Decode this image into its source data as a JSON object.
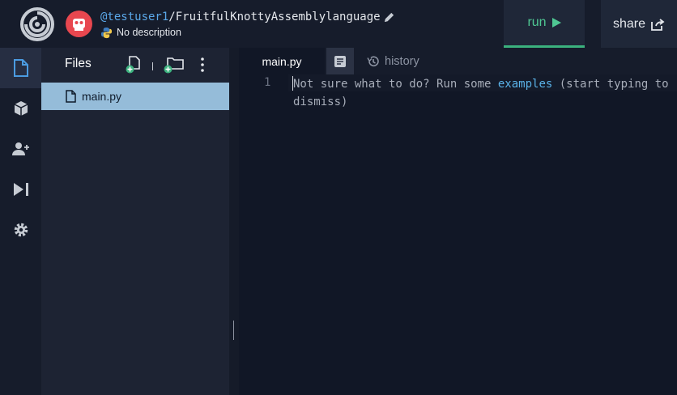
{
  "header": {
    "username": "@testuser1",
    "separator": "/",
    "repl_name": "FruitfulKnottyAssemblylanguage",
    "description": "No description",
    "run_label": "run",
    "share_label": "share"
  },
  "rail": {
    "items": [
      {
        "icon": "files-icon"
      },
      {
        "icon": "packages-icon"
      },
      {
        "icon": "add-user-icon"
      },
      {
        "icon": "debugger-icon"
      },
      {
        "icon": "settings-icon"
      }
    ]
  },
  "files": {
    "title": "Files",
    "divider": "|",
    "items": [
      {
        "name": "main.py"
      }
    ]
  },
  "editor": {
    "tabs": {
      "main": "main.py",
      "history": "history"
    },
    "line_number": "1",
    "hint_before": "Not sure what to do? Run some ",
    "hint_link": "examples",
    "hint_after": " (start typing to dismiss)"
  },
  "colors": {
    "accent_green": "#4fc793",
    "link_blue": "#5ab2e8",
    "selected_file": "#95bcd9",
    "avatar": "#e8474f"
  }
}
